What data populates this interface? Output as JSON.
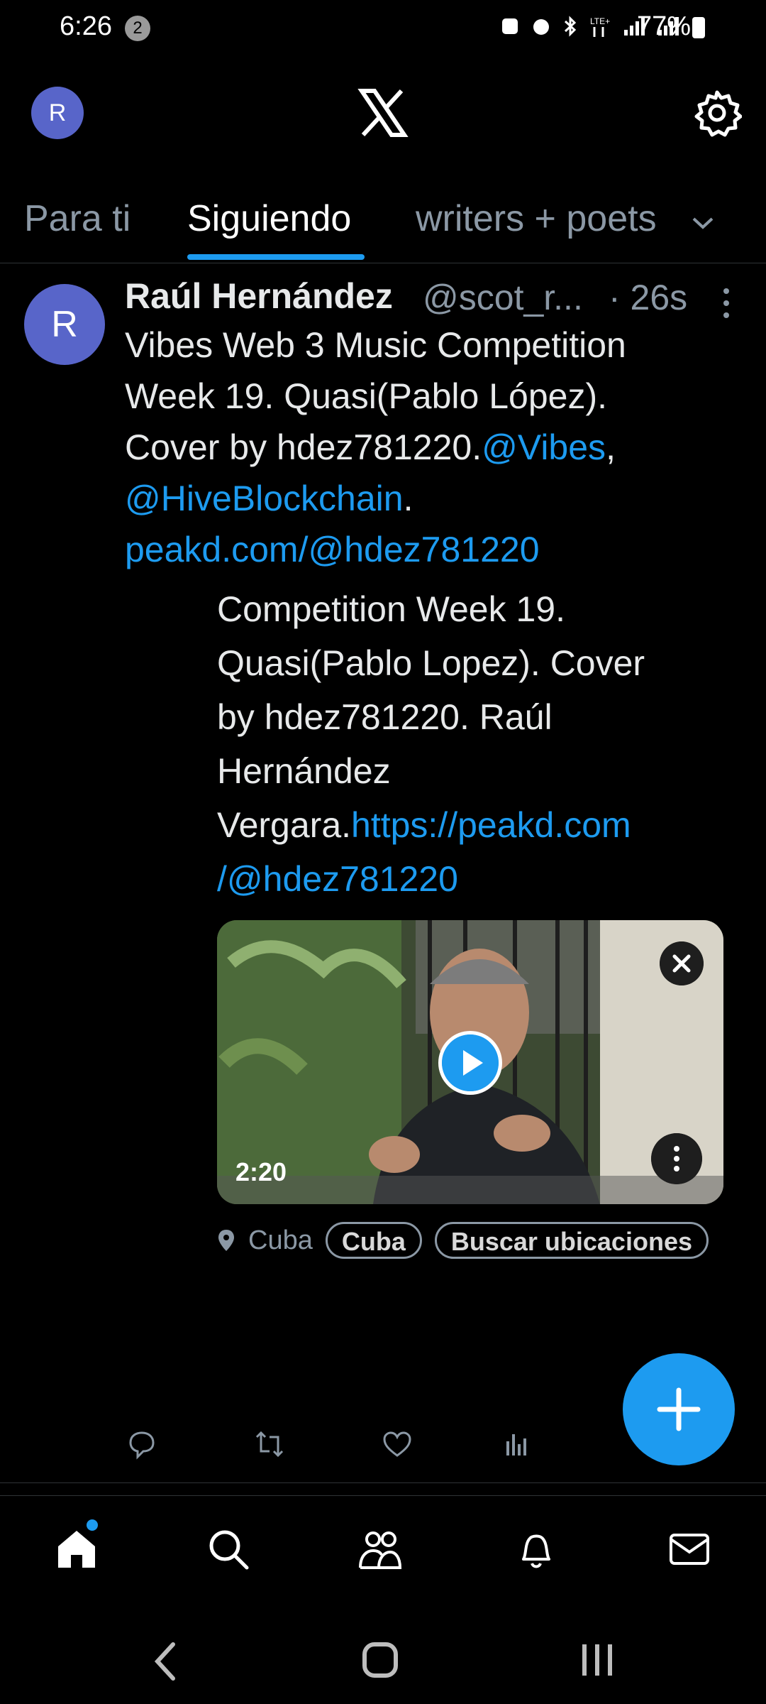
{
  "status_bar": {
    "time": "6:26",
    "notif_count": "2",
    "battery": "77%"
  },
  "header": {
    "avatar_initial": "R"
  },
  "tabs": [
    {
      "label": "Para ti"
    },
    {
      "label": "Siguiendo"
    },
    {
      "label": "writers + poets"
    }
  ],
  "post": {
    "avatar_initial": "R",
    "author": "Raúl Hernández",
    "handle": "@scot_r...",
    "time_ago": "· 26s",
    "text_lines": [
      "Vibes Web 3 Music Competition",
      "Week 19. Quasi(Pablo López).",
      "Cover by hdez781220."
    ],
    "mention_vibes": "@Vibes",
    "comma": ",",
    "mention_hive": "@HiveBlockchain",
    "period": ".",
    "link": "peakd.com/@hdez781220",
    "card_lines": [
      "Competition Week 19.",
      "Quasi(Pablo Lopez). Cover",
      "by hdez781220. Raúl",
      "Hernández"
    ],
    "card_last_text": "Vergara.",
    "card_link_1": "https://peakd.com",
    "card_link_2": "/@hdez781220",
    "video_duration": "2:20",
    "location": {
      "label": "Cuba",
      "chip_1": "Cuba",
      "chip_2": "Buscar ubicaciones"
    }
  },
  "colors": {
    "accent": "#1d9bf0",
    "avatar": "#5865c9",
    "background": "#000000"
  }
}
